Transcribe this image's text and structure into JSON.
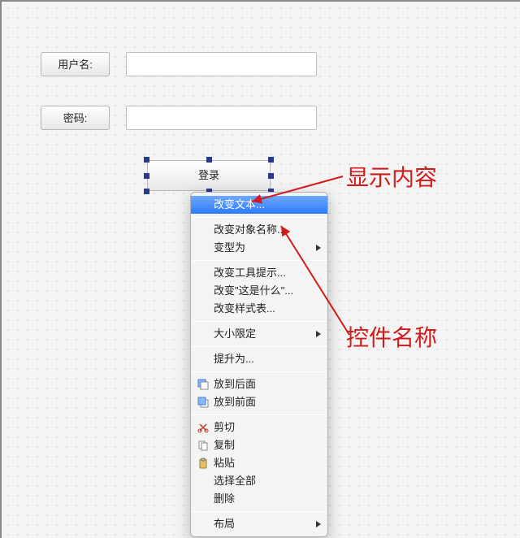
{
  "labels": {
    "username": "用户名:",
    "password": "密码:"
  },
  "login_button": "登录",
  "menu": {
    "change_text": "改变文本...",
    "change_object_name": "改变对象名称...",
    "morph_into": "变型为",
    "change_tooltip": "改变工具提示...",
    "change_whatsthis": "改变\"这是什么\"...",
    "change_stylesheet": "改变样式表...",
    "size_constraints": "大小限定",
    "promote_to": "提升为...",
    "send_to_back": "放到后面",
    "bring_to_front": "放到前面",
    "cut": "剪切",
    "copy": "复制",
    "paste": "粘贴",
    "select_all": "选择全部",
    "delete": "删除",
    "layout": "布局"
  },
  "annotations": {
    "display_content": "显示内容",
    "widget_name": "控件名称"
  }
}
